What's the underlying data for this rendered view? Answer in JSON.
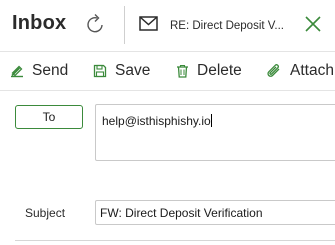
{
  "header": {
    "title": "Inbox",
    "message_title": "RE: Direct Deposit V..."
  },
  "toolbar": {
    "send_label": "Send",
    "save_label": "Save",
    "delete_label": "Delete",
    "attach_label": "Attach"
  },
  "compose": {
    "to_label": "To",
    "to_value": "help@isthisphishy.io",
    "subject_label": "Subject",
    "subject_value": "FW: Direct Deposit Verification"
  },
  "colors": {
    "accent_green": "#3b8a3b",
    "text": "#2b2b2b",
    "border": "#c9c9c9"
  },
  "icons": {
    "refresh": "refresh-icon",
    "mail": "mail-icon",
    "close": "close-icon",
    "send": "send-icon",
    "save": "save-icon",
    "delete": "trash-icon",
    "attach": "paperclip-icon"
  }
}
